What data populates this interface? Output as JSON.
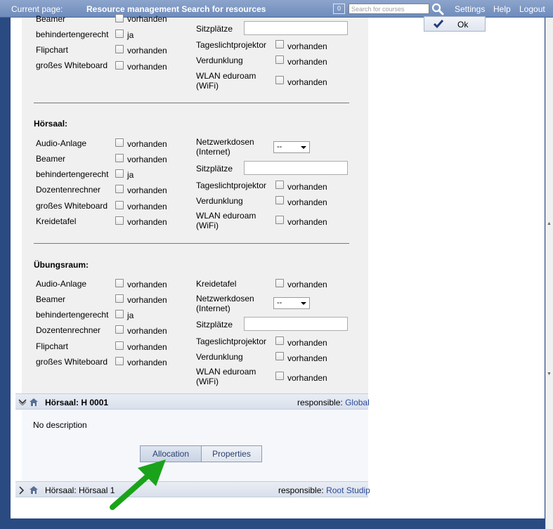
{
  "topbar": {
    "current_page_label": "Current page:",
    "title": "Resource management  Search for resources",
    "notification_count": "0",
    "search_placeholder": "Search for courses",
    "settings": "Settings",
    "help": "Help",
    "logout": "Logout"
  },
  "ok_button": "Ok",
  "top_section": {
    "left": [
      {
        "label": "Beamer",
        "value": "vorhanden"
      },
      {
        "label": "behindertengerecht",
        "value": "ja"
      },
      {
        "label": "Flipchart",
        "value": "vorhanden"
      },
      {
        "label": "großes Whiteboard",
        "value": "vorhanden"
      }
    ],
    "right": [
      {
        "label": "Sitzplätze"
      },
      {
        "label": "Tageslichtprojektor",
        "value": "vorhanden"
      },
      {
        "label": "Verdunklung",
        "value": "vorhanden"
      },
      {
        "label": "WLAN eduroam (WiFi)",
        "value": "vorhanden"
      }
    ]
  },
  "hoersaal": {
    "title": "Hörsaal:",
    "left": [
      {
        "label": "Audio-Anlage",
        "value": "vorhanden"
      },
      {
        "label": "Beamer",
        "value": "vorhanden"
      },
      {
        "label": "behindertengerecht",
        "value": "ja"
      },
      {
        "label": "Dozentenrechner",
        "value": "vorhanden"
      },
      {
        "label": "großes Whiteboard",
        "value": "vorhanden"
      },
      {
        "label": "Kreidetafel",
        "value": "vorhanden"
      }
    ],
    "right": [
      {
        "label": "Netzwerkdosen (Internet)",
        "select": "--"
      },
      {
        "label": "Sitzplätze"
      },
      {
        "label": "Tageslichtprojektor",
        "value": "vorhanden"
      },
      {
        "label": "Verdunklung",
        "value": "vorhanden"
      },
      {
        "label": "WLAN eduroam (WiFi)",
        "value": "vorhanden"
      }
    ]
  },
  "uebungsraum": {
    "title": "Übungsraum:",
    "left": [
      {
        "label": "Audio-Anlage",
        "value": "vorhanden"
      },
      {
        "label": "Beamer",
        "value": "vorhanden"
      },
      {
        "label": "behindertengerecht",
        "value": "ja"
      },
      {
        "label": "Dozentenrechner",
        "value": "vorhanden"
      },
      {
        "label": "Flipchart",
        "value": "vorhanden"
      },
      {
        "label": "großes Whiteboard",
        "value": "vorhanden"
      }
    ],
    "right": [
      {
        "label": "Kreidetafel",
        "value": "vorhanden"
      },
      {
        "label": "Netzwerkdosen (Internet)",
        "select": "--"
      },
      {
        "label": "Sitzplätze"
      },
      {
        "label": "Tageslichtprojektor",
        "value": "vorhanden"
      },
      {
        "label": "Verdunklung",
        "value": "vorhanden"
      },
      {
        "label": "WLAN eduroam (WiFi)",
        "value": "vorhanden"
      }
    ]
  },
  "resources": [
    {
      "name": "Hörsaal: H 0001",
      "responsible_label": "responsible:",
      "responsible": "Global",
      "description": "No description",
      "tabs": [
        "Allocation",
        "Properties"
      ]
    },
    {
      "name": "Hörsaal: Hörsaal 1",
      "responsible_label": "responsible:",
      "responsible": "Root Studip"
    }
  ],
  "colors": {
    "topbar": "#7f98c4",
    "frame": "#2a4a82",
    "panel": "#f0f0f0",
    "link": "#2c4a99",
    "arrow": "#1aa31a"
  }
}
